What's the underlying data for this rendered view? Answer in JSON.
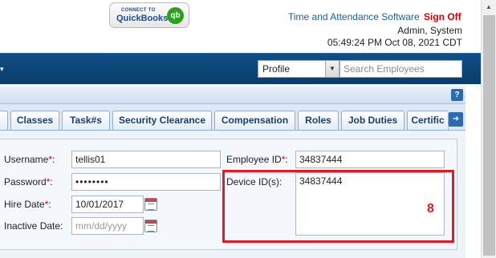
{
  "header": {
    "quickbooks_connect": "CONNECT TO",
    "quickbooks_name": "QuickBooks",
    "quickbooks_badge": "qb",
    "tas_link": "Time and Attendance Software",
    "signoff_link": "Sign Off",
    "user": "Admin, System",
    "datetime": "05:49:24 PM Oct 08, 2021 CDT"
  },
  "nav": {
    "profile_selected": "Profile",
    "search_placeholder": "Search Employees"
  },
  "tabs": [
    {
      "label": "Classes"
    },
    {
      "label": "Task#s"
    },
    {
      "label": "Security Clearance"
    },
    {
      "label": "Compensation"
    },
    {
      "label": "Roles"
    },
    {
      "label": "Job Duties"
    },
    {
      "label": "Certific"
    }
  ],
  "form": {
    "username_label": "Username",
    "username_value": "tellis01",
    "password_label": "Password",
    "password_value": "••••••••",
    "hire_date_label": "Hire Date",
    "hire_date_value": "10/01/2017",
    "inactive_date_label": "Inactive Date:",
    "inactive_date_placeholder": "mm/dd/yyyy",
    "employee_id_label": "Employee ID",
    "employee_id_value": "34837444",
    "device_ids_label": "Device ID(s):",
    "device_ids_value": "34837444",
    "required_mark": "*",
    "colon": ":"
  },
  "annotation": {
    "number": "8",
    "color": "#e01b24"
  },
  "colors": {
    "navbar": "#0f4e84",
    "tab_text": "#1b3f6b",
    "required": "#d40000",
    "link": "#1c5c96"
  }
}
